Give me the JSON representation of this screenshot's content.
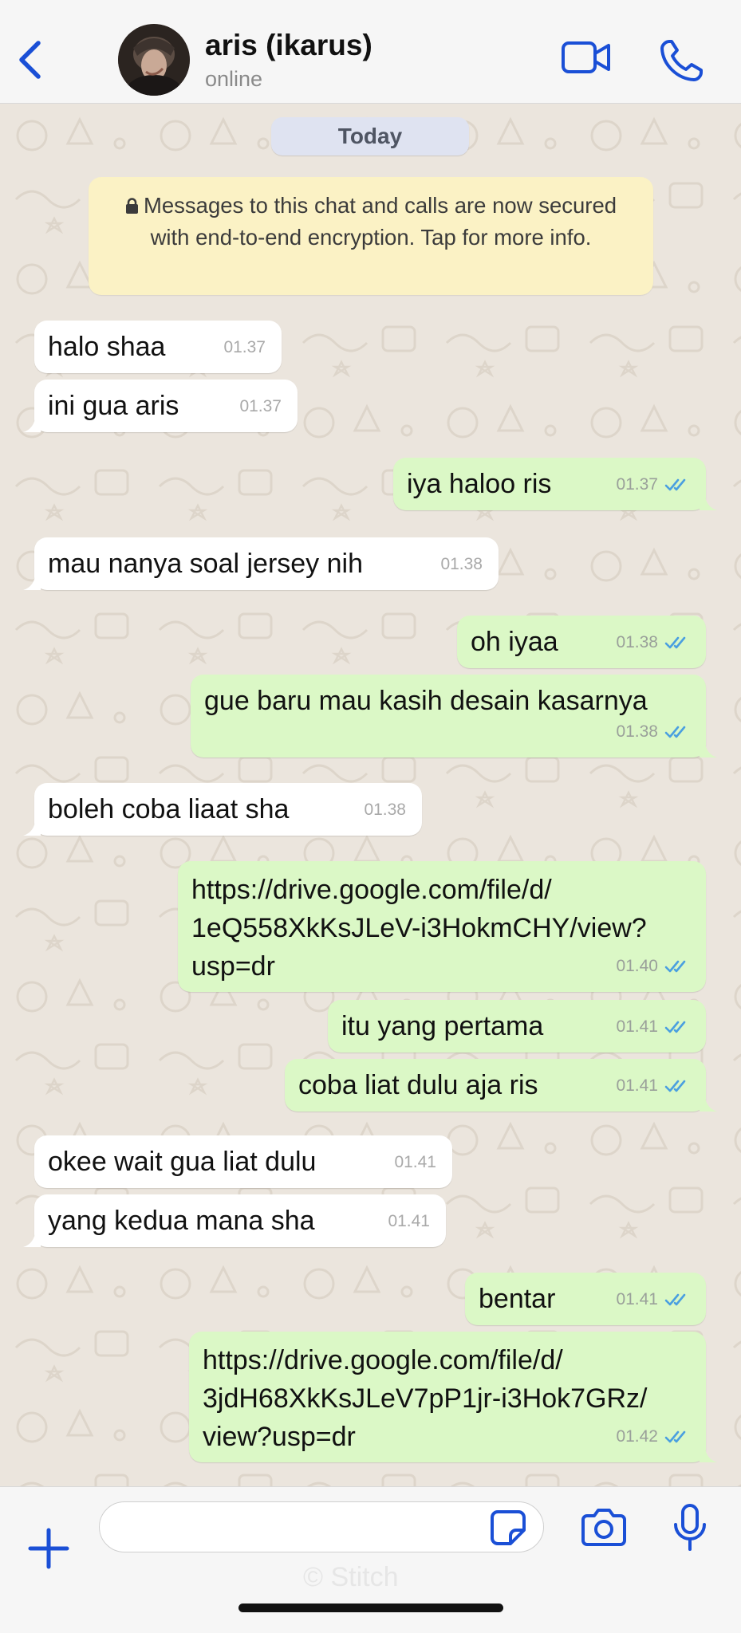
{
  "header": {
    "contact_name": "aris (ikarus)",
    "status": "online"
  },
  "chat": {
    "date_label": "Today",
    "encryption_notice": "Messages to this chat and calls are now secured with end-to-end encryption. Tap for more info.",
    "messages": [
      {
        "dir": "in",
        "text": "halo shaa",
        "time": "01.37"
      },
      {
        "dir": "in",
        "text": "ini gua aris",
        "time": "01.37"
      },
      {
        "dir": "out",
        "text": "iya haloo ris",
        "time": "01.37",
        "status": "read"
      },
      {
        "dir": "in",
        "text": "mau nanya soal jersey nih",
        "time": "01.38"
      },
      {
        "dir": "out",
        "text": "oh iyaa",
        "time": "01.38",
        "status": "read"
      },
      {
        "dir": "out",
        "text": "gue baru mau kasih desain kasarnya",
        "time": "01.38",
        "status": "read"
      },
      {
        "dir": "in",
        "text": "boleh coba liaat sha",
        "time": "01.38"
      },
      {
        "dir": "out",
        "text": "https://drive.google.com/file/d/\n1eQ558XkKsJLeV-i3HokmCHY/view?\nusp=dr",
        "time": "01.40",
        "status": "read"
      },
      {
        "dir": "out",
        "text": "itu yang pertama",
        "time": "01.41",
        "status": "read"
      },
      {
        "dir": "out",
        "text": "coba liat dulu aja ris",
        "time": "01.41",
        "status": "read"
      },
      {
        "dir": "in",
        "text": "okee wait gua liat dulu",
        "time": "01.41"
      },
      {
        "dir": "in",
        "text": "yang kedua mana sha",
        "time": "01.41"
      },
      {
        "dir": "out",
        "text": "bentar",
        "time": "01.41",
        "status": "read"
      },
      {
        "dir": "out",
        "text": "https://drive.google.com/file/d/\n3jdH68XkKsJLeV7pP1jr-i3Hok7GRz/\nview?usp=dr",
        "time": "01.42",
        "status": "read"
      }
    ]
  },
  "composer": {
    "input_value": "",
    "watermark": "© Stitch"
  },
  "colors": {
    "accent": "#1a4fd6",
    "incoming_bubble": "#ffffff",
    "outgoing_bubble": "#dbf8c6",
    "chat_background": "#ebe5dd",
    "read_ticks": "#4a9fe0"
  },
  "icons": {
    "back": "chevron-left-icon",
    "video_call": "video-camera-icon",
    "voice_call": "phone-icon",
    "attach": "plus-icon",
    "sticker": "sticker-icon",
    "camera": "camera-icon",
    "microphone": "microphone-icon",
    "lock": "lock-icon",
    "read_receipt": "double-check-icon"
  }
}
